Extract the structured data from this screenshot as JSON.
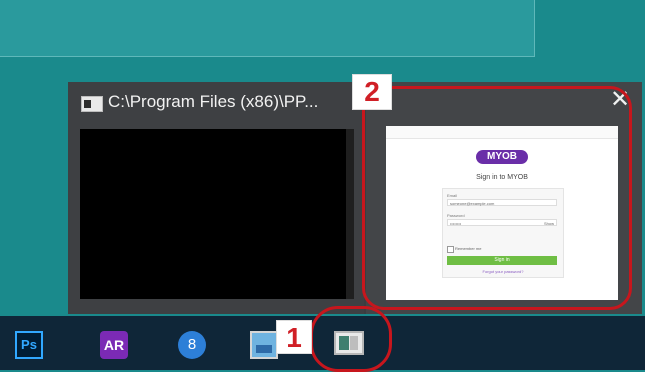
{
  "thumbnails": {
    "left": {
      "title": "C:\\Program Files (x86)\\PP..."
    },
    "right": {
      "close_symbol": "✕",
      "preview": {
        "brand": "MYOB",
        "title": "Sign in to MYOB",
        "email_label": "Email",
        "email_value": "someone@example.com",
        "password_label": "Password",
        "password_value": "••••••••",
        "show_label": "Show",
        "remember_label": "Remember me",
        "signin_label": "Sign in",
        "forgot_label": "Forgot your password?"
      }
    }
  },
  "annotations": {
    "badge_1": "1",
    "badge_2": "2",
    "highlight_color": "#c7161d"
  },
  "taskbar": {
    "photoshop_label": "Ps",
    "ar_label": "AR",
    "edge_label": "8"
  },
  "colors": {
    "desktop": "#1a8a8c",
    "thumbnail_bg": "#3b3d40",
    "taskbar": "#0f2638"
  }
}
